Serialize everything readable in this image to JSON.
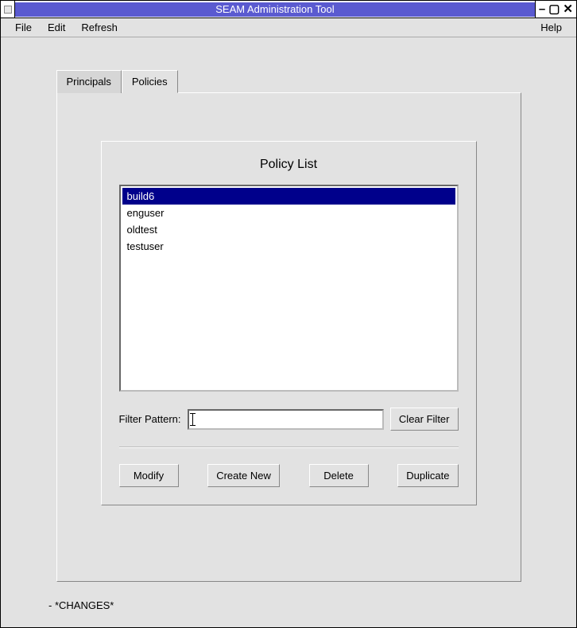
{
  "window": {
    "title": "SEAM Administration Tool"
  },
  "menubar": {
    "file": "File",
    "edit": "Edit",
    "refresh": "Refresh",
    "help": "Help"
  },
  "tabs": {
    "principals": "Principals",
    "policies": "Policies"
  },
  "panel": {
    "title": "Policy List",
    "items": [
      "build6",
      "enguser",
      "oldtest",
      "testuser"
    ],
    "selected_index": 0,
    "filter_label": "Filter Pattern:",
    "filter_value": "",
    "clear_filter": "Clear Filter",
    "modify": "Modify",
    "create_new": "Create New",
    "delete": "Delete",
    "duplicate": "Duplicate"
  },
  "status": "- *CHANGES*"
}
